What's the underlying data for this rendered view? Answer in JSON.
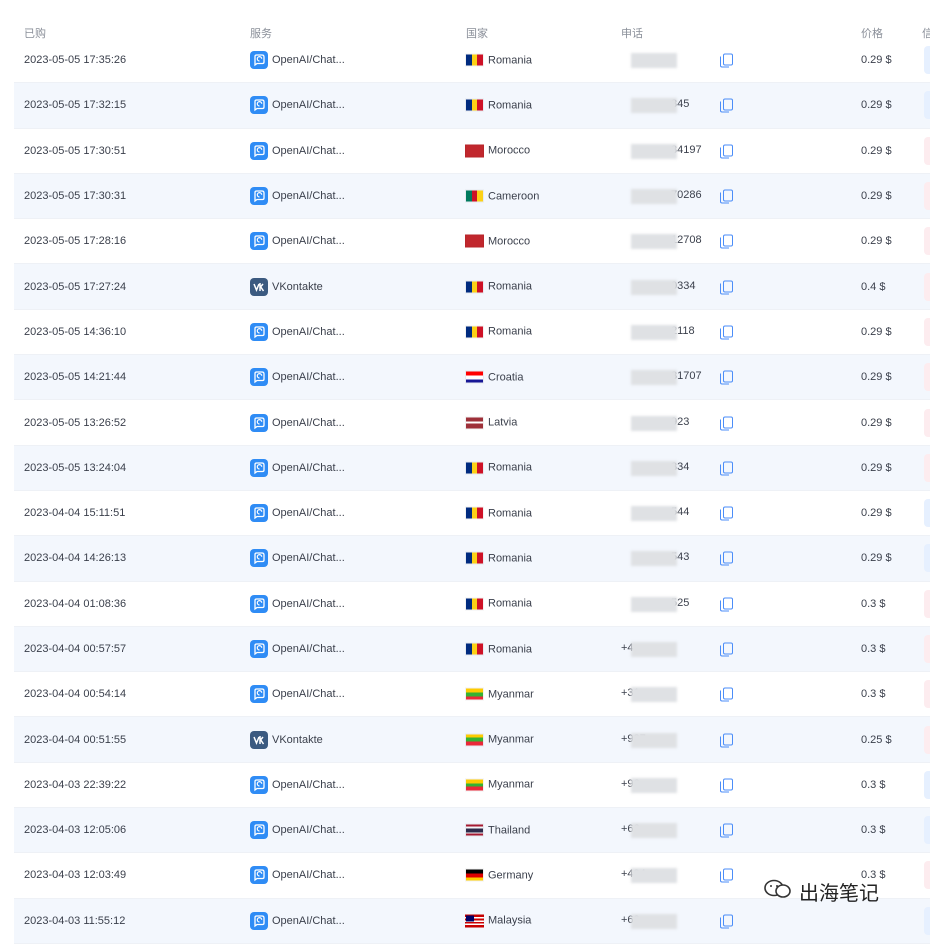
{
  "header": {
    "date": "已购",
    "service": "服务",
    "country": "国家",
    "phone": "申话",
    "price": "价格",
    "status": "信"
  },
  "rows": [
    {
      "date": "2023-05-05 17:35:26",
      "service": "OpenAI/Chat...",
      "service_icon": "openai",
      "country": "Romania",
      "flag": "ro",
      "phone": "",
      "price": "0.29 $",
      "status": "blue"
    },
    {
      "date": "2023-05-05 17:32:15",
      "service": "OpenAI/Chat...",
      "service_icon": "openai",
      "country": "Romania",
      "flag": "ro",
      "phone": "345",
      "price": "0.29 $",
      "status": "blue"
    },
    {
      "date": "2023-05-05 17:30:51",
      "service": "OpenAI/Chat...",
      "service_icon": "openai",
      "country": "Morocco",
      "flag": "ma",
      "phone": "34197",
      "price": "0.29 $",
      "status": "pink"
    },
    {
      "date": "2023-05-05 17:30:31",
      "service": "OpenAI/Chat...",
      "service_icon": "openai",
      "country": "Cameroon",
      "flag": "cm",
      "phone": "70286",
      "price": "0.29 $",
      "status": "pink"
    },
    {
      "date": "2023-05-05 17:28:16",
      "service": "OpenAI/Chat...",
      "service_icon": "openai",
      "country": "Morocco",
      "flag": "ma",
      "phone": "12708",
      "price": "0.29 $",
      "status": "pink"
    },
    {
      "date": "2023-05-05 17:27:24",
      "service": "VKontakte",
      "service_icon": "vk",
      "country": "Romania",
      "flag": "ro",
      "phone": "0334",
      "price": "0.4 $",
      "status": "pink"
    },
    {
      "date": "2023-05-05 14:36:10",
      "service": "OpenAI/Chat...",
      "service_icon": "openai",
      "country": "Romania",
      "flag": "ro",
      "phone": "2118",
      "price": "0.29 $",
      "status": "pink"
    },
    {
      "date": "2023-05-05 14:21:44",
      "service": "OpenAI/Chat...",
      "service_icon": "openai",
      "country": "Croatia",
      "flag": "hr",
      "phone": "31707",
      "price": "0.29 $",
      "status": "pink"
    },
    {
      "date": "2023-05-05 13:26:52",
      "service": "OpenAI/Chat...",
      "service_icon": "openai",
      "country": "Latvia",
      "flag": "lv",
      "phone": "923",
      "price": "0.29 $",
      "status": "pink"
    },
    {
      "date": "2023-05-05 13:24:04",
      "service": "OpenAI/Chat...",
      "service_icon": "openai",
      "country": "Romania",
      "flag": "ro",
      "phone": "334",
      "price": "0.29 $",
      "status": "pink"
    },
    {
      "date": "2023-04-04 15:11:51",
      "service": "OpenAI/Chat...",
      "service_icon": "openai",
      "country": "Romania",
      "flag": "ro",
      "phone": "544",
      "price": "0.29 $",
      "status": "blue"
    },
    {
      "date": "2023-04-04 14:26:13",
      "service": "OpenAI/Chat...",
      "service_icon": "openai",
      "country": "Romania",
      "flag": "ro",
      "phone": "543",
      "price": "0.29 $",
      "status": "blue"
    },
    {
      "date": "2023-04-04 01:08:36",
      "service": "OpenAI/Chat...",
      "service_icon": "openai",
      "country": "Romania",
      "flag": "ro",
      "phone": "525",
      "price": "0.3 $",
      "status": "pink"
    },
    {
      "date": "2023-04-04 00:57:57",
      "service": "OpenAI/Chat...",
      "service_icon": "openai",
      "country": "Romania",
      "flag": "ro",
      "phone": "+4",
      "price": "0.3 $",
      "status": "pink"
    },
    {
      "date": "2023-04-04 00:54:14",
      "service": "OpenAI/Chat...",
      "service_icon": "openai",
      "country": "Myanmar",
      "flag": "mm",
      "phone": "+31",
      "price": "0.3 $",
      "status": "pink"
    },
    {
      "date": "2023-04-04 00:51:55",
      "service": "VKontakte",
      "service_icon": "vk",
      "country": "Myanmar",
      "flag": "mm",
      "phone": "+927",
      "price": "0.25 $",
      "status": "pink"
    },
    {
      "date": "2023-04-03 22:39:22",
      "service": "OpenAI/Chat...",
      "service_icon": "openai",
      "country": "Myanmar",
      "flag": "mm",
      "phone": "+96",
      "price": "0.3 $",
      "status": "blue"
    },
    {
      "date": "2023-04-03 12:05:06",
      "service": "OpenAI/Chat...",
      "service_icon": "openai",
      "country": "Thailand",
      "flag": "th",
      "phone": "+66",
      "price": "0.3 $",
      "status": "blue"
    },
    {
      "date": "2023-04-03 12:03:49",
      "service": "OpenAI/Chat...",
      "service_icon": "openai",
      "country": "Germany",
      "flag": "de",
      "phone": "+494",
      "price": "0.3 $",
      "status": "pink"
    },
    {
      "date": "2023-04-03 11:55:12",
      "service": "OpenAI/Chat...",
      "service_icon": "openai",
      "country": "Malaysia",
      "flag": "my",
      "phone": "+60",
      "price": "",
      "status": "blue"
    }
  ],
  "watermark": {
    "text": "出海笔记",
    "icon": "wechat-icon"
  },
  "colors": {
    "accent": "#4b8df8",
    "openai_icon": "#2f8cf5",
    "vk_icon": "#3b5a80",
    "status_blue": "#e6f0ff",
    "status_pink": "#fdecef",
    "row_alt": "#f3f7fd"
  }
}
